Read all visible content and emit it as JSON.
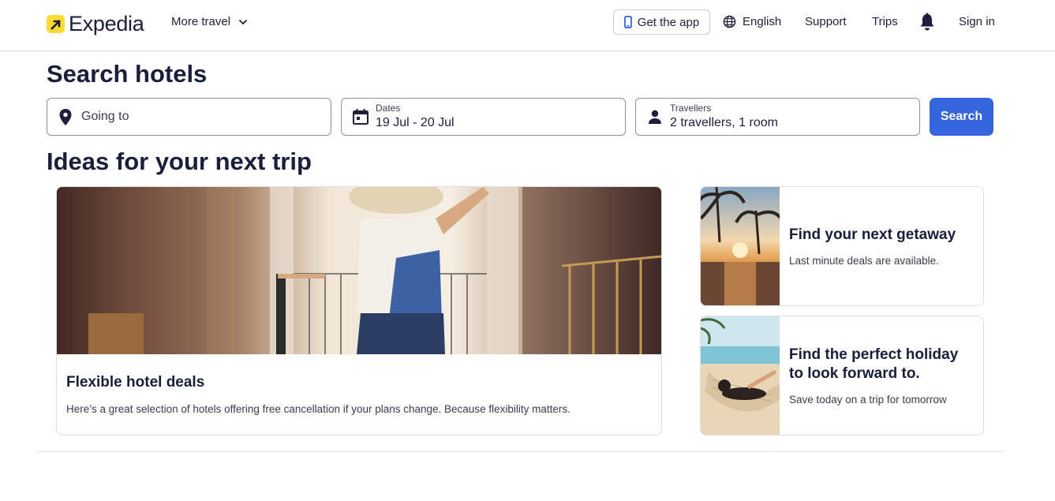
{
  "brand": {
    "name": "Expedia",
    "accent": "#fddb32",
    "primary": "#3565dc"
  },
  "header": {
    "more_travel": "More travel",
    "get_app": "Get the app",
    "language": "English",
    "support": "Support",
    "trips": "Trips",
    "sign_in": "Sign in",
    "icons": [
      "chevron-down-icon",
      "phone-icon",
      "globe-icon",
      "bell-icon"
    ]
  },
  "search": {
    "title": "Search hotels",
    "going_to": {
      "placeholder": "Going to"
    },
    "dates": {
      "label": "Dates",
      "value": "19 Jul - 20 Jul"
    },
    "travellers": {
      "label": "Travellers",
      "value": "2 travellers, 1 room"
    },
    "button": "Search"
  },
  "ideas": {
    "title": "Ideas for your next trip",
    "cards": [
      {
        "title": "Flexible hotel deals",
        "description": "Here’s a great selection of hotels offering free cancellation if your plans change. Because flexibility matters."
      },
      {
        "title": "Find your next getaway",
        "description": "Last minute deals are available."
      },
      {
        "title": "Find the perfect holiday to look forward to.",
        "description": "Save today on a trip for tomorrow"
      }
    ]
  }
}
